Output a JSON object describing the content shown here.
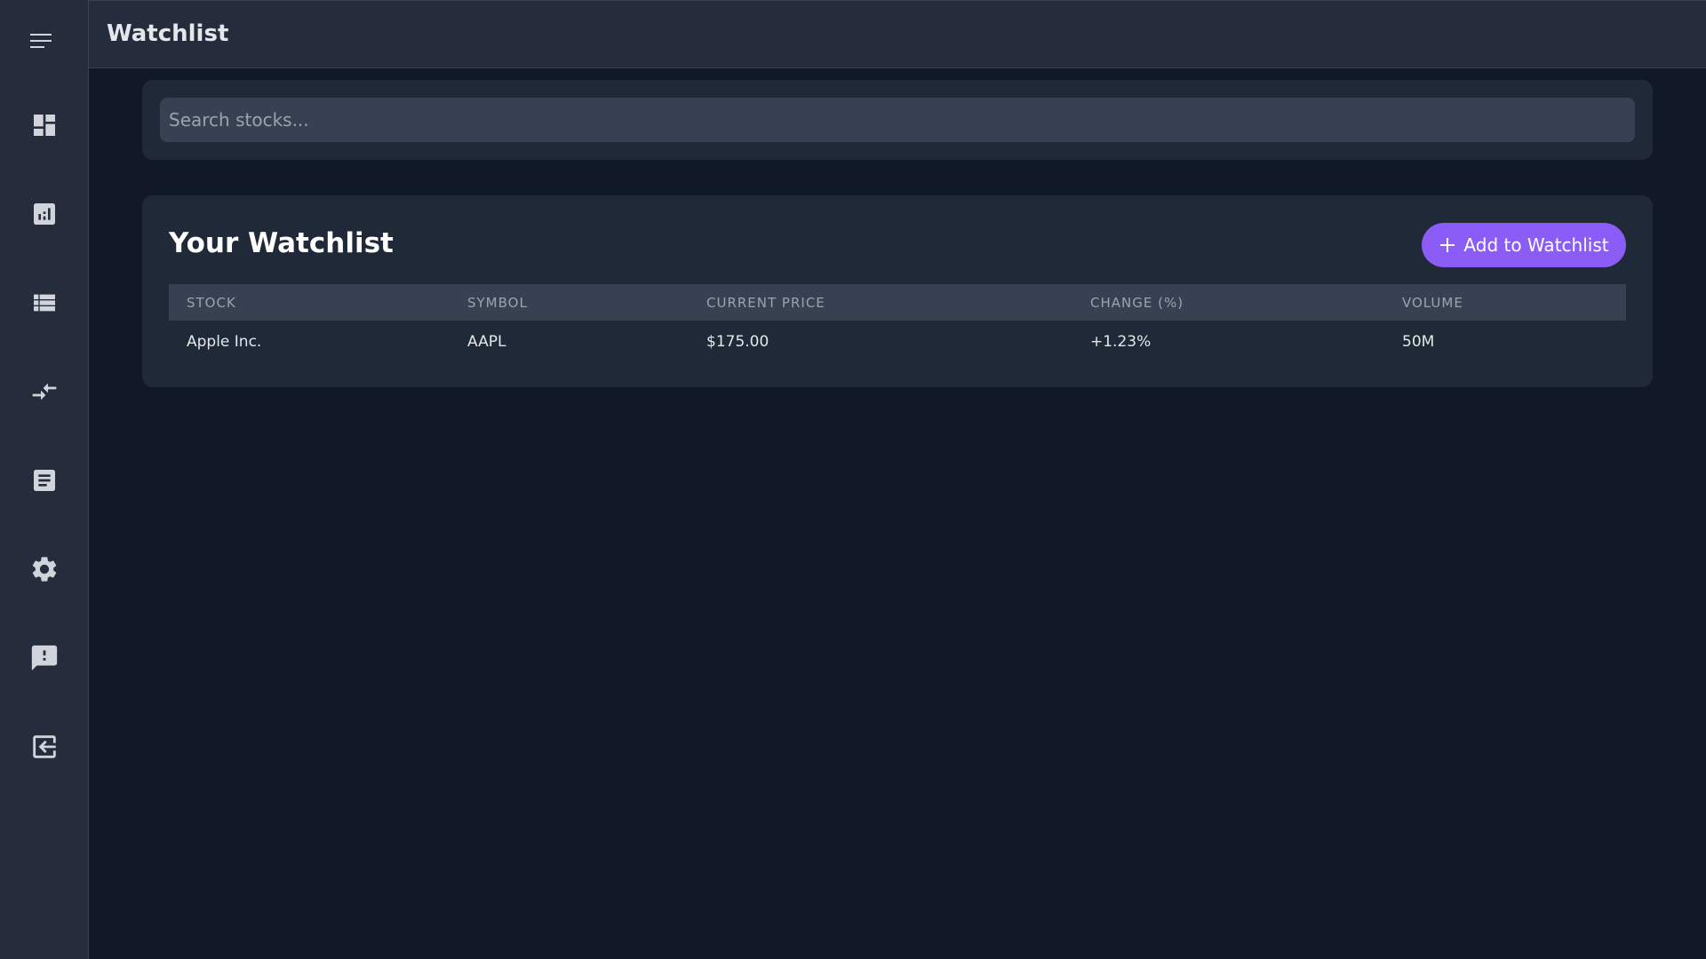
{
  "header": {
    "title": "Watchlist"
  },
  "sidebar": {
    "items": [
      {
        "icon": "dashboard-icon"
      },
      {
        "icon": "analytics-icon"
      },
      {
        "icon": "list-icon"
      },
      {
        "icon": "compare-arrows-icon"
      },
      {
        "icon": "article-icon"
      },
      {
        "icon": "settings-icon"
      },
      {
        "icon": "feedback-icon"
      },
      {
        "icon": "logout-icon"
      }
    ]
  },
  "search": {
    "placeholder": "Search stocks..."
  },
  "watchlist": {
    "title": "Your Watchlist",
    "add_button_label": "Add to Watchlist",
    "columns": [
      "STOCK",
      "SYMBOL",
      "CURRENT PRICE",
      "CHANGE (%)",
      "VOLUME"
    ],
    "rows": [
      {
        "stock": "Apple Inc.",
        "symbol": "AAPL",
        "price": "$175.00",
        "change": "+1.23%",
        "volume": "50M"
      }
    ]
  },
  "colors": {
    "accent": "#8b5cf6",
    "positive": "#34d399",
    "background": "#111827",
    "card": "#1f2937"
  }
}
